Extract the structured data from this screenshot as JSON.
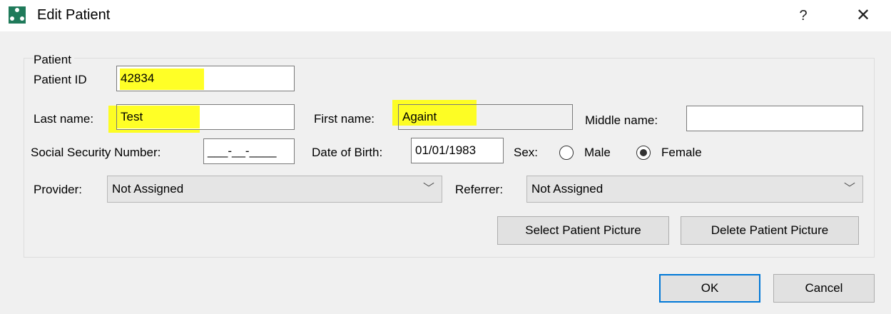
{
  "window": {
    "title": "Edit Patient",
    "help_label": "?",
    "close_label": "✕",
    "app_icon": "radiation-icon"
  },
  "patient_group": {
    "legend": "Patient",
    "patient_id_label": "Patient ID",
    "patient_id_value": "42834",
    "last_name_label": "Last name:",
    "last_name_value": "Test",
    "first_name_label": "First name:",
    "first_name_value": "Againt",
    "middle_name_label": "Middle name:",
    "middle_name_value": "",
    "ssn_label": "Social Security Number:",
    "ssn_value": "___-__-____",
    "dob_label": "Date of Birth:",
    "dob_value": "01/01/1983",
    "sex_label": "Sex:",
    "sex_options": [
      {
        "label": "Male",
        "selected": false
      },
      {
        "label": "Female",
        "selected": true
      }
    ],
    "provider_label": "Provider:",
    "provider_value": "Not Assigned",
    "referrer_label": "Referrer:",
    "referrer_value": "Not Assigned",
    "select_picture_label": "Select Patient Picture",
    "delete_picture_label": "Delete Patient Picture"
  },
  "footer": {
    "ok_label": "OK",
    "cancel_label": "Cancel"
  },
  "colors": {
    "highlight": "#ffff00",
    "default_button_border": "#0078d7",
    "icon_green": "#1f7a5a"
  }
}
